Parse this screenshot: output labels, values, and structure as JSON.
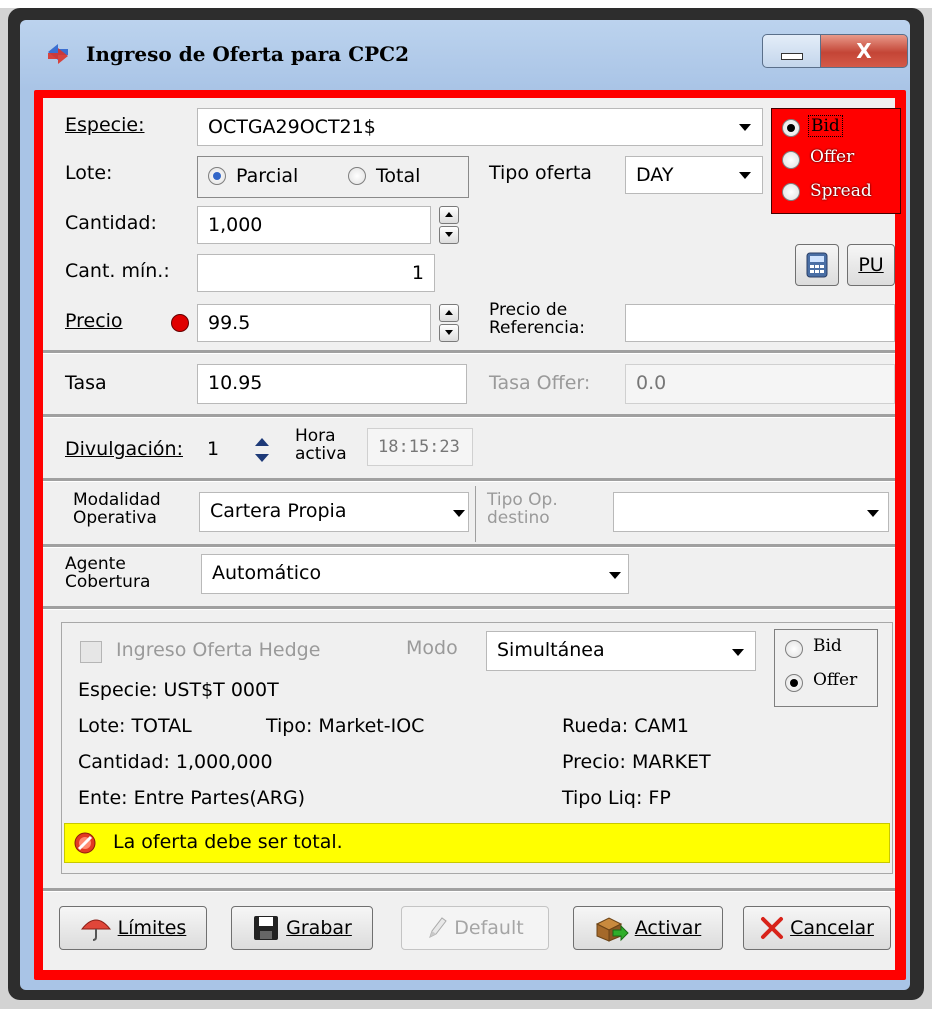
{
  "window": {
    "title": "Ingreso de Oferta para CPC2",
    "close_label": "X"
  },
  "form": {
    "especie_label": "Especie:",
    "especie_value": "OCTGA29OCT21$",
    "lote_label": "Lote:",
    "lote_options": [
      "Parcial",
      "Total"
    ],
    "lote_selected": "Parcial",
    "tipo_oferta_label": "Tipo oferta",
    "tipo_oferta_value": "DAY",
    "side_options": [
      "Bid",
      "Offer",
      "Spread"
    ],
    "side_selected": "Bid",
    "cantidad_label": "Cantidad:",
    "cantidad_value": "1,000",
    "cant_min_label": "Cant. mín.:",
    "cant_min_value": "1",
    "pu_label": "PU",
    "precio_label": "Precio",
    "precio_value": "99.5",
    "precio_ref_label_1": "Precio de",
    "precio_ref_label_2": "Referencia:",
    "precio_ref_value": "",
    "tasa_label": "Tasa",
    "tasa_value": "10.95",
    "tasa_offer_label": "Tasa Offer:",
    "tasa_offer_value": "0.0",
    "divulgacion_label": "Divulgación:",
    "divulgacion_value": "1",
    "hora_activa_label_1": "Hora",
    "hora_activa_label_2": "activa",
    "hora_activa_value": "18:15:23",
    "modalidad_label_1": "Modalidad",
    "modalidad_label_2": "Operativa",
    "modalidad_value": "Cartera Propia",
    "tipo_op_label_1": "Tipo Op.",
    "tipo_op_label_2": "destino",
    "tipo_op_value": "",
    "agente_label_1": "Agente",
    "agente_label_2": "Cobertura",
    "agente_value": "Automático"
  },
  "hedge": {
    "checkbox_label": "Ingreso Oferta Hedge",
    "modo_label": "Modo",
    "modo_value": "Simultánea",
    "side_options": [
      "Bid",
      "Offer"
    ],
    "side_selected": "Offer",
    "especie": "Especie: UST$T   000T",
    "lote": "Lote: TOTAL",
    "tipo": "Tipo: Market-IOC",
    "rueda": "Rueda: CAM1",
    "cantidad": "Cantidad: 1,000,000",
    "precio": "Precio: MARKET",
    "ente": "Ente: Entre Partes(ARG)",
    "tipo_liq": "Tipo Liq: FP",
    "warning": "La oferta debe ser total."
  },
  "buttons": {
    "limites": "Límites",
    "grabar": "Grabar",
    "default": "Default",
    "activar": "Activar",
    "cancelar": "Cancelar"
  },
  "colors": {
    "accent_red": "#ff0000",
    "warning_yellow": "#ffff00",
    "titlebar": "#a9c4e6"
  }
}
